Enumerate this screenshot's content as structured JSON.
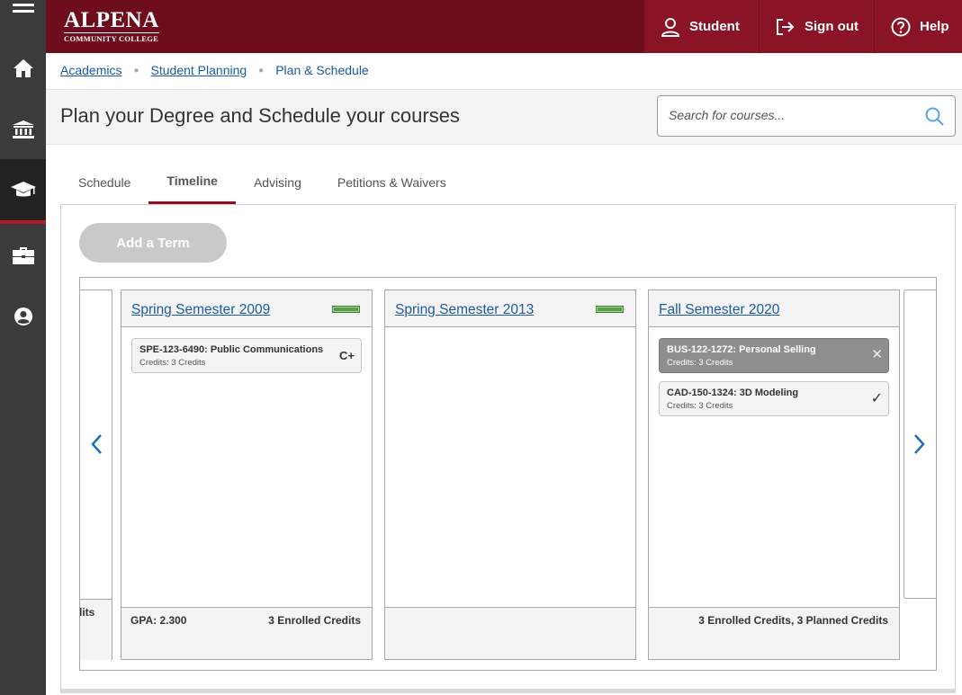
{
  "brand": {
    "line1": "ALPENA",
    "line2": "COMMUNITY COLLEGE"
  },
  "nav_rail": {
    "items": [
      {
        "icon": "menu-icon"
      },
      {
        "icon": "home-icon"
      },
      {
        "icon": "institution-icon"
      },
      {
        "icon": "graduation-cap-icon",
        "active": true
      },
      {
        "icon": "briefcase-icon"
      },
      {
        "icon": "user-circle-icon"
      }
    ]
  },
  "header": {
    "student_label": "Student",
    "signout_label": "Sign out",
    "help_label": "Help"
  },
  "breadcrumb": {
    "items": [
      "Academics",
      "Student Planning",
      "Plan & Schedule"
    ]
  },
  "page": {
    "title": "Plan your Degree and Schedule your courses",
    "search_placeholder": "Search for courses..."
  },
  "tabs": [
    {
      "label": "Schedule"
    },
    {
      "label": "Timeline",
      "active": true
    },
    {
      "label": "Advising"
    },
    {
      "label": "Petitions & Waivers"
    }
  ],
  "timeline": {
    "add_term_label": "Add a Term",
    "partial_footer": "lits",
    "terms": [
      {
        "name": "Spring Semester 2009",
        "courses": [
          {
            "title": "SPE-123-6490: Public Communications",
            "credits": "Credits: 3 Credits",
            "grade": "C+"
          }
        ],
        "footer_left": "GPA: 2.300",
        "footer_right": "3 Enrolled Credits"
      },
      {
        "name": "Spring Semester 2013",
        "courses": [],
        "footer_left": "",
        "footer_right": ""
      },
      {
        "name": "Fall Semester 2020",
        "courses": [
          {
            "title": "BUS-122-1272: Personal Selling",
            "credits": "Credits: 3 Credits",
            "status_mark": "✕"
          },
          {
            "title": "CAD-150-1324: 3D Modeling",
            "credits": "Credits: 3 Credits",
            "status_mark": "✓"
          }
        ],
        "footer_left": "",
        "footer_right": "3 Enrolled Credits, 3 Planned Credits"
      }
    ]
  },
  "colors": {
    "header": "#6e0d1c",
    "header_buttons": "#8a1426",
    "link": "#1b5aa6",
    "progress_green": "#5c9a4c"
  }
}
